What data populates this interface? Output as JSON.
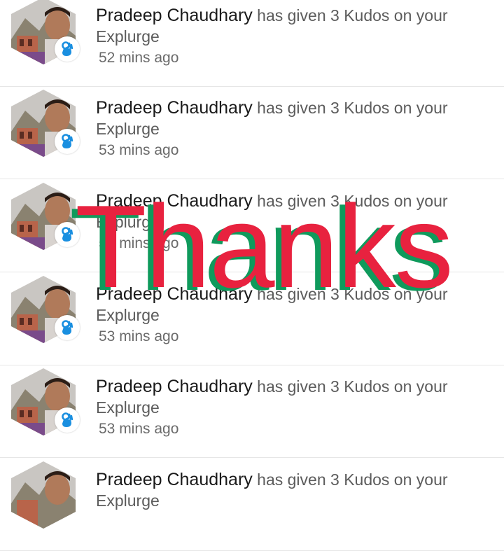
{
  "notifications": [
    {
      "name": "Pradeep Chaudhary",
      "action": "has given 3 Kudos on your",
      "object": "Explurge",
      "time": "52 mins ago"
    },
    {
      "name": "Pradeep Chaudhary",
      "action": "has given 3 Kudos on your",
      "object": "Explurge",
      "time": "53 mins ago"
    },
    {
      "name": "Pradeep Chaudhary",
      "action": "has given 3 Kudos on your",
      "object": "Explurge",
      "time": "53 mins ago"
    },
    {
      "name": "Pradeep Chaudhary",
      "action": "has given 3 Kudos on your",
      "object": "Explurge",
      "time": "53 mins ago"
    },
    {
      "name": "Pradeep Chaudhary",
      "action": "has given 3 Kudos on your",
      "object": "Explurge",
      "time": "53 mins ago"
    },
    {
      "name": "Pradeep Chaudhary",
      "action": "has given 3 Kudos on your",
      "object": "Explurge",
      "time": ""
    }
  ],
  "overlay": {
    "text": "Thanks",
    "front_color": "#e8223f",
    "shadow_color": "#0f9a5c"
  },
  "icons": {
    "avatar": "hexagon-avatar",
    "badge": "ok-hand-icon"
  }
}
